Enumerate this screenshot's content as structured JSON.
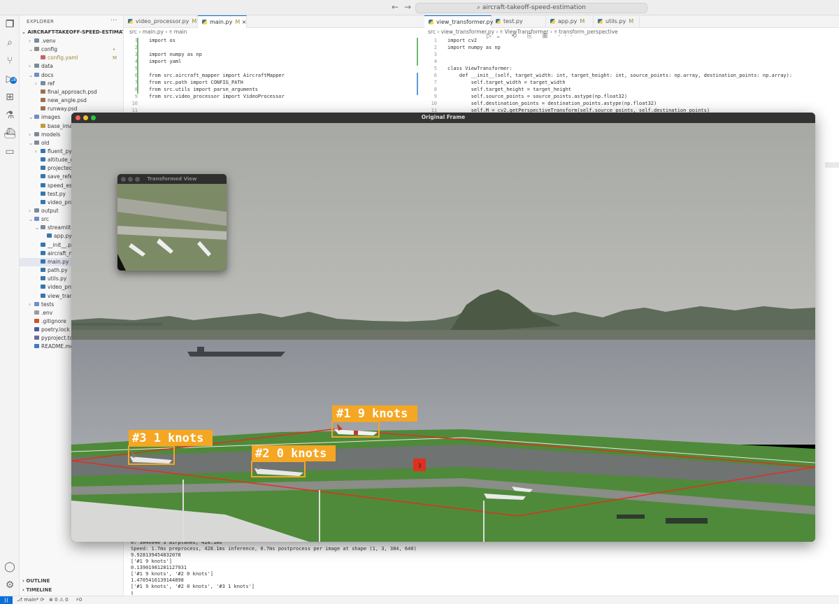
{
  "titlebar": {
    "back_label": "←",
    "forward_label": "→",
    "command_center": "aircraft-takeoff-speed-estimation"
  },
  "activity_bar": {
    "icons": [
      "files-icon",
      "search-icon",
      "source-control-icon",
      "run-debug-icon",
      "extensions-icon",
      "testing-icon",
      "docker-icon",
      "remote-explorer-icon",
      "account-icon",
      "settings-gear-icon"
    ],
    "source_control_badge": "18"
  },
  "explorer": {
    "title": "EXPLORER",
    "more": "···",
    "root": "AIRCRAFT-TAKEOFF-SPEED-ESTIMATION",
    "items": [
      {
        "label": ".venv",
        "mark": ""
      },
      {
        "label": "config",
        "mark": "•"
      },
      {
        "label": "config.yaml",
        "mark": "M"
      },
      {
        "label": "data",
        "mark": ""
      },
      {
        "label": "docs",
        "mark": ""
      },
      {
        "label": "ref",
        "mark": ""
      },
      {
        "label": "final_approach.psd",
        "mark": ""
      },
      {
        "label": "new_angle.psd",
        "mark": ""
      },
      {
        "label": "runway.psd",
        "mark": ""
      },
      {
        "label": "images",
        "mark": ""
      },
      {
        "label": "base_image",
        "mark": ""
      },
      {
        "label": "models",
        "mark": ""
      },
      {
        "label": "old",
        "mark": ""
      },
      {
        "label": "fluent_pyth",
        "mark": ""
      },
      {
        "label": "altitude_de",
        "mark": ""
      },
      {
        "label": "projected_",
        "mark": ""
      },
      {
        "label": "save_refere",
        "mark": ""
      },
      {
        "label": "speed_esti",
        "mark": ""
      },
      {
        "label": "test.py",
        "mark": ""
      },
      {
        "label": "video_proc",
        "mark": ""
      },
      {
        "label": "output",
        "mark": ""
      },
      {
        "label": "src",
        "mark": ""
      },
      {
        "label": "streamlit",
        "mark": ""
      },
      {
        "label": "app.py",
        "mark": ""
      },
      {
        "label": "__init__.py",
        "mark": ""
      },
      {
        "label": "aircraft_ma",
        "mark": ""
      },
      {
        "label": "main.py",
        "mark": ""
      },
      {
        "label": "path.py",
        "mark": ""
      },
      {
        "label": "utils.py",
        "mark": ""
      },
      {
        "label": "video_proc",
        "mark": ""
      },
      {
        "label": "view_transf",
        "mark": ""
      },
      {
        "label": "tests",
        "mark": ""
      },
      {
        "label": ".env",
        "mark": ""
      },
      {
        "label": ".gitignore",
        "mark": ""
      },
      {
        "label": "poetry.lock",
        "mark": ""
      },
      {
        "label": "pyproject.to",
        "mark": ""
      },
      {
        "label": "README.md",
        "mark": ""
      }
    ],
    "outline": "OUTLINE",
    "timeline": "TIMELINE"
  },
  "editor_left": {
    "tabs": [
      {
        "label": "video_processor.py",
        "status": "M"
      },
      {
        "label": "main.py",
        "status": "M"
      }
    ],
    "actions": "▷⌄ ⟲ ⎘ ⊞ ···",
    "breadcrumb": "src › main.py › ⌾ main",
    "line_numbers": "1\n2\n3\n4\n5\n6\n7\n8\n9\n10\n11",
    "code": [
      "import os",
      "",
      "import numpy as np",
      "import yaml",
      "",
      "from src.aircraft_mapper import AircraftMapper",
      "from src.path import CONFIG_PATH",
      "from src.utils import parse_arguments",
      "from src.video_processor import VideoProcessor",
      "",
      ""
    ]
  },
  "editor_right": {
    "tabs": [
      {
        "label": "view_transformer.py",
        "status": "U"
      },
      {
        "label": "test.py",
        "status": ""
      },
      {
        "label": "app.py",
        "status": "M"
      },
      {
        "label": "utils.py",
        "status": "M"
      }
    ],
    "breadcrumb": "src › view_transformer.py › ⌾ ViewTransformer › ⌾ transform_perspective",
    "line_numbers": "1\n2\n3\n4\n5\n6\n7\n8\n9\n10\n11",
    "code": [
      "import cv2",
      "import numpy as np",
      "",
      "",
      "class ViewTransformer:",
      "    def __init__(self, target_width: int, target_height: int, source_points: np.array, destination_points: np.array):",
      "        self.target_width = target_width",
      "        self.target_height = target_height",
      "        self.source_points = source_points.astype(np.float32)",
      "        self.destination_points = destination_points.astype(np.float32)",
      "        self.M = cv2.getPerspectiveTransform(self.source_points, self.destination_points)"
    ]
  },
  "terminal": {
    "lines": [
      "0: 384x640 3 airplanes, 428.1ms",
      "Speed: 1.7ms preprocess, 428.1ms inference, 0.7ms postprocess per image at shape (1, 3, 384, 640)",
      "9.928139454832078",
      "['#1 9 knots']",
      "0.13901981281127931",
      "['#1 9 knots', '#2 0 knots']",
      "1.4705416139144898",
      "['#1 9 knots', '#2 0 knots', '#3 1 knots']",
      "▯"
    ]
  },
  "statusbar": {
    "remote": "⟩⟨",
    "branch": "⎇ main*  ⟳",
    "errors": "⊗ 0 ⚠ 0",
    "ports": "⚡0"
  },
  "original_window": {
    "title": "Original Frame",
    "runway_region_label": "3",
    "detections": [
      {
        "label": "#1 9 knots",
        "speed_knots": 9
      },
      {
        "label": "#2 0 knots",
        "speed_knots": 0
      },
      {
        "label": "#3 1 knots",
        "speed_knots": 1
      }
    ],
    "colors": {
      "box": "#f5a623",
      "region": "#e03020",
      "label_text": "#ffffff"
    }
  },
  "transformed_window": {
    "title": "Transformed View"
  }
}
